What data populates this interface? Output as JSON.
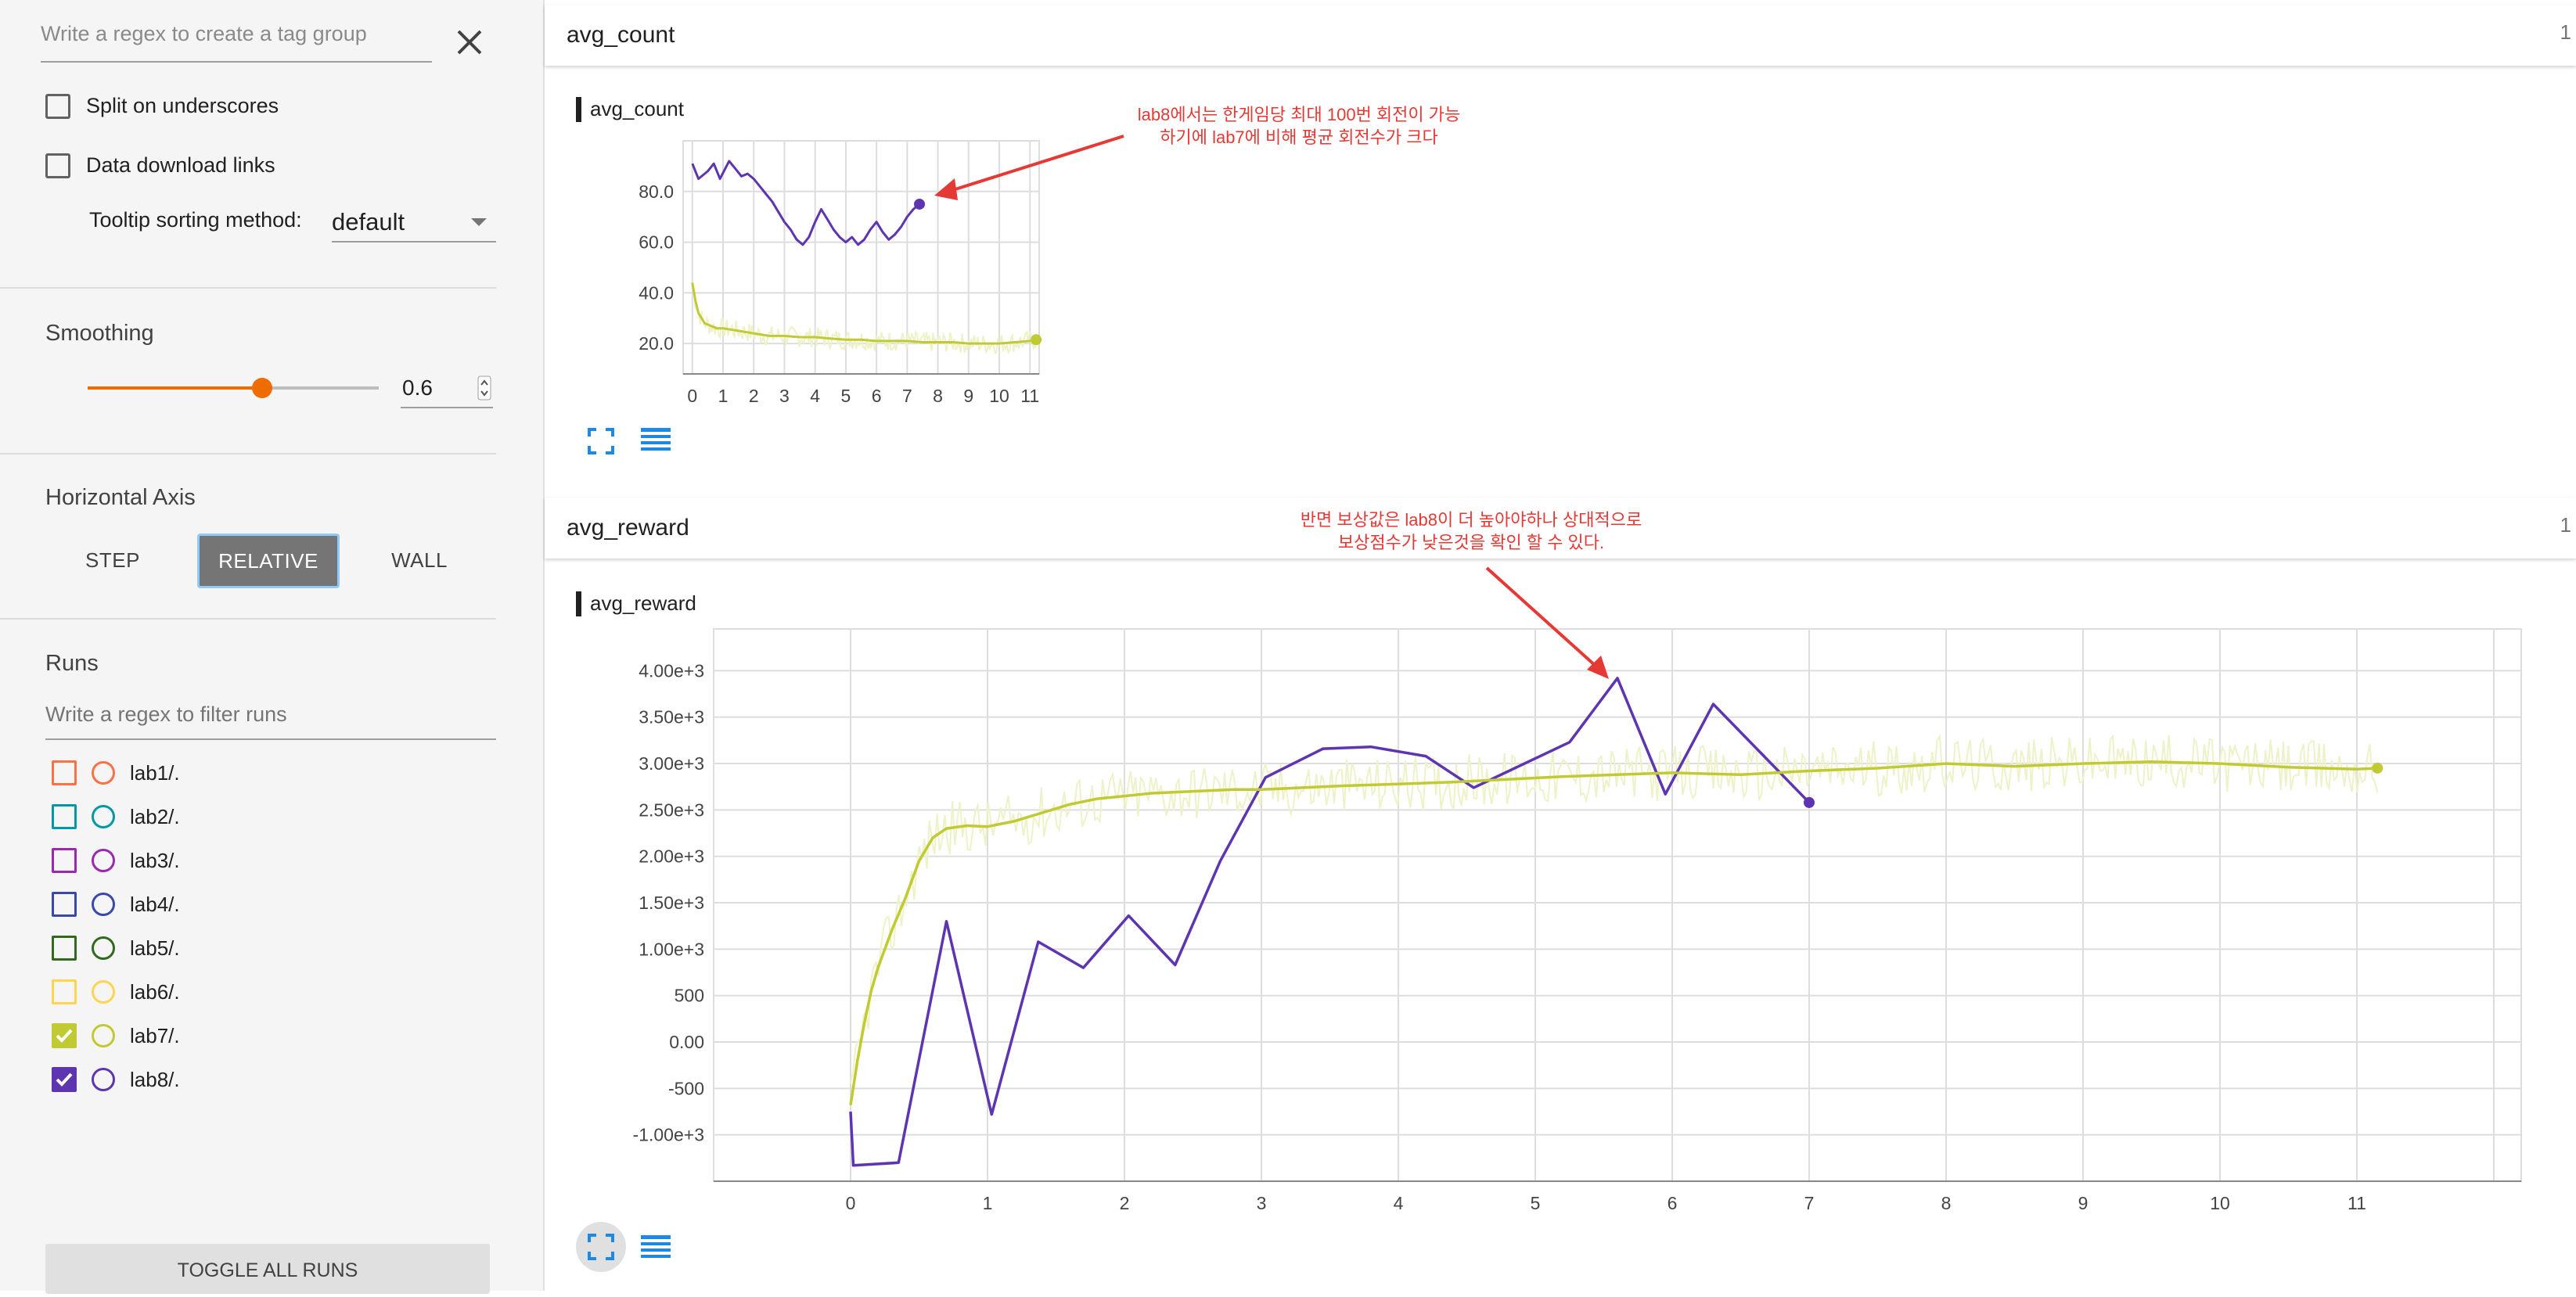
{
  "sidebar": {
    "tag_regex_placeholder": "Write a regex to create a tag group",
    "split_underscores_label": "Split on underscores",
    "data_download_label": "Data download links",
    "tooltip_sort_label": "Tooltip sorting method:",
    "tooltip_sort_value": "default",
    "smoothing_label": "Smoothing",
    "smoothing_value": "0.6",
    "smoothing_fraction": 0.6,
    "horizontal_axis_label": "Horizontal Axis",
    "axis_buttons": [
      "STEP",
      "RELATIVE",
      "WALL"
    ],
    "axis_selected": "RELATIVE",
    "runs_label": "Runs",
    "runs_filter_placeholder": "Write a regex to filter runs",
    "runs": [
      {
        "label": "lab1/.",
        "color": "#ff7043",
        "checked": false
      },
      {
        "label": "lab2/.",
        "color": "#0097a7",
        "checked": false
      },
      {
        "label": "lab3/.",
        "color": "#9c27b0",
        "checked": false
      },
      {
        "label": "lab4/.",
        "color": "#3949ab",
        "checked": false
      },
      {
        "label": "lab5/.",
        "color": "#33691e",
        "checked": false
      },
      {
        "label": "lab6/.",
        "color": "#ffd54f",
        "checked": false
      },
      {
        "label": "lab7/.",
        "color": "#c0ca33",
        "checked": true
      },
      {
        "label": "lab8/.",
        "color": "#5e35b1",
        "checked": true
      }
    ],
    "toggle_all_label": "TOGGLE ALL RUNS"
  },
  "panes": [
    {
      "title": "avg_count",
      "count": "1"
    },
    {
      "title": "avg_reward",
      "count": "1"
    }
  ],
  "annotations": {
    "count_note": [
      "lab8에서는 한게임당 최대 100번 회전이 가능",
      "하기에 lab7에 비해 평균 회전수가 크다"
    ],
    "reward_note": [
      "반면 보상값은 lab8이 더 높아야하나 상대적으로",
      "보상점수가 낮은것을 확인 할 수 있다."
    ]
  },
  "colors": {
    "lab7": "#c0ca33",
    "lab7_raw": "#eef2c8",
    "lab8": "#5e35b1",
    "accent": "#ef6c00",
    "icon_blue": "#1e88e5",
    "annotation": "#e53935"
  },
  "icons": {
    "close": "close-icon",
    "dropdown": "chevron-down-icon",
    "fullscreen": "fullscreen-icon",
    "data_table": "data-table-icon"
  },
  "chart_data": [
    {
      "type": "line",
      "title": "avg_count",
      "xlabel": "",
      "ylabel": "",
      "xlim": [
        -0.3,
        11.3
      ],
      "ylim": [
        8,
        100
      ],
      "x_ticks": [
        0,
        1,
        2,
        3,
        4,
        5,
        6,
        7,
        8,
        9,
        10,
        11
      ],
      "y_ticks": [
        20,
        40,
        60,
        80
      ],
      "y_tick_labels": [
        "20.0",
        "40.0",
        "60.0",
        "80.0"
      ],
      "grid": true,
      "series": [
        {
          "name": "lab8/.",
          "x": [
            0,
            0.2,
            0.5,
            0.7,
            0.9,
            1.2,
            1.4,
            1.6,
            1.8,
            2.0,
            2.2,
            2.4,
            2.6,
            2.8,
            3.0,
            3.2,
            3.4,
            3.6,
            3.8,
            4.0,
            4.2,
            4.4,
            4.6,
            4.8,
            5.0,
            5.2,
            5.4,
            5.6,
            5.8,
            6.0,
            6.2,
            6.4,
            6.6,
            6.8,
            7.0,
            7.2,
            7.4
          ],
          "y": [
            91,
            85,
            88,
            91,
            85,
            92,
            89,
            86,
            87,
            85,
            82,
            79,
            76,
            72,
            68,
            65,
            61,
            59,
            62,
            68,
            73,
            69,
            65,
            62,
            60,
            62,
            59,
            61,
            65,
            68,
            64,
            61,
            63,
            66,
            70,
            73,
            75
          ]
        },
        {
          "name": "lab7/.",
          "x": [
            0,
            0.1,
            0.2,
            0.4,
            0.6,
            0.8,
            1.0,
            1.5,
            2.0,
            2.5,
            3.0,
            3.5,
            4.0,
            4.5,
            5.0,
            5.5,
            6.0,
            6.5,
            7.0,
            7.5,
            8.0,
            8.5,
            9.0,
            9.5,
            10.0,
            10.5,
            11.0,
            11.2
          ],
          "y": [
            44,
            37,
            32,
            28,
            27,
            26,
            26,
            25,
            24,
            23,
            23,
            22.5,
            22.5,
            22,
            21.5,
            21.5,
            21,
            21,
            21,
            20.5,
            20.5,
            20.5,
            20,
            20,
            20,
            20.5,
            21,
            21.5
          ]
        }
      ]
    },
    {
      "type": "line",
      "title": "avg_reward",
      "xlabel": "",
      "ylabel": "",
      "xlim": [
        -1,
        12.2
      ],
      "ylim": [
        -1500,
        4450
      ],
      "x_ticks": [
        0,
        1,
        2,
        3,
        4,
        5,
        6,
        7,
        8,
        9,
        10,
        11
      ],
      "y_ticks": [
        -1000,
        -500,
        0,
        500,
        1000,
        1500,
        2000,
        2500,
        3000,
        3500,
        4000
      ],
      "y_tick_labels": [
        "-1.00e+3",
        "-500",
        "0.00",
        "500",
        "1.00e+3",
        "1.50e+3",
        "2.00e+3",
        "2.50e+3",
        "3.00e+3",
        "3.50e+3",
        "4.00e+3"
      ],
      "grid": true,
      "series": [
        {
          "name": "lab8/.",
          "x": [
            0,
            0.02,
            0.35,
            0.7,
            1.03,
            1.37,
            1.7,
            2.03,
            2.37,
            2.7,
            3.03,
            3.45,
            3.8,
            4.2,
            4.55,
            5.25,
            5.6,
            5.95,
            6.3,
            7.0
          ],
          "y": [
            -750,
            -1330,
            -1300,
            1300,
            -780,
            1080,
            800,
            1360,
            830,
            1950,
            2850,
            3160,
            3180,
            3080,
            2740,
            3230,
            3920,
            2670,
            3640,
            2580
          ]
        },
        {
          "name": "lab7/.",
          "x": [
            0,
            0.05,
            0.1,
            0.15,
            0.2,
            0.3,
            0.4,
            0.5,
            0.6,
            0.7,
            0.85,
            1.0,
            1.2,
            1.4,
            1.6,
            1.8,
            2.0,
            2.2,
            2.5,
            2.8,
            3.0,
            3.3,
            3.6,
            4.0,
            4.4,
            4.8,
            5.2,
            5.6,
            6.0,
            6.5,
            7.0,
            7.5,
            8.0,
            8.5,
            9.0,
            9.5,
            10.0,
            10.5,
            11.0,
            11.15
          ],
          "y": [
            -680,
            -200,
            200,
            550,
            800,
            1200,
            1550,
            1950,
            2200,
            2300,
            2330,
            2320,
            2380,
            2470,
            2560,
            2620,
            2650,
            2680,
            2700,
            2720,
            2720,
            2740,
            2760,
            2780,
            2800,
            2830,
            2860,
            2880,
            2900,
            2880,
            2920,
            2950,
            3000,
            2970,
            3000,
            3020,
            3000,
            2960,
            2940,
            2950
          ]
        }
      ]
    }
  ]
}
